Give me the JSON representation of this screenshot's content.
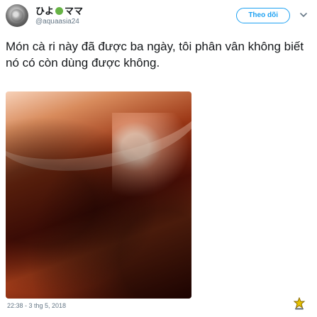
{
  "header": {
    "name_prefix": "ひよ",
    "name_suffix": "ママ",
    "handle": "@aquaasia24",
    "follow_label": "Theo dõi"
  },
  "tweet": {
    "text": "Món cà ri này đã được ba ngày, tôi phân vân không biết nó có còn dùng được không.",
    "timestamp": "22:38 - 3 thg 5, 2018"
  },
  "colors": {
    "accent": "#1da1f2",
    "secondary_text": "#657786",
    "primary_text": "#14171a",
    "emoji_green": "#67b345",
    "react_icon": "#b8860b"
  },
  "icons": {
    "dropdown": "chevron-down-icon",
    "avatar": "avatar",
    "react": "star-badge-icon"
  }
}
